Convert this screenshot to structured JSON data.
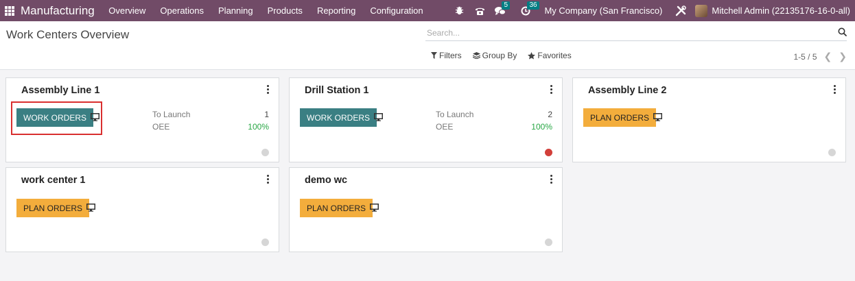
{
  "navbar": {
    "app_name": "Manufacturing",
    "menu": [
      "Overview",
      "Operations",
      "Planning",
      "Products",
      "Reporting",
      "Configuration"
    ],
    "messages_count": "5",
    "activities_count": "36",
    "company": "My Company (San Francisco)",
    "user": "Mitchell Admin (22135176-16-0-all)"
  },
  "control": {
    "title": "Work Centers Overview",
    "search_placeholder": "Search...",
    "filters": "Filters",
    "group_by": "Group By",
    "favorites": "Favorites",
    "pager": "1-5 / 5"
  },
  "cards": [
    {
      "name": "Assembly Line 1",
      "button": "WORK ORDERS",
      "to_launch_label": "To Launch",
      "to_launch": "1",
      "oee_label": "OEE",
      "oee": "100%",
      "status": "grey"
    },
    {
      "name": "Drill Station 1",
      "button": "WORK ORDERS",
      "to_launch_label": "To Launch",
      "to_launch": "2",
      "oee_label": "OEE",
      "oee": "100%",
      "status": "red"
    },
    {
      "name": "Assembly Line 2",
      "button": "PLAN ORDERS",
      "status": "grey"
    },
    {
      "name": "work center 1",
      "button": "PLAN ORDERS",
      "status": "grey"
    },
    {
      "name": "demo wc",
      "button": "PLAN ORDERS",
      "status": "grey"
    }
  ],
  "colors": {
    "navbar": "#714b67",
    "work_orders_button": "#3a7f83",
    "plan_orders_button": "#f3ad3c",
    "oee_value": "#28a745",
    "status_red": "#d23f3a",
    "status_grey": "#d6d6d6",
    "highlight": "#d92f2f"
  }
}
